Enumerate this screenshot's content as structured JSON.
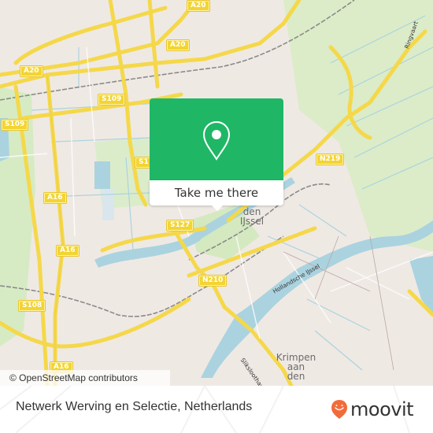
{
  "map": {
    "attribution": "© OpenStreetMap contributors",
    "popup": {
      "button_label": "Take me there",
      "icon": "location-pin-icon",
      "accent_color": "#1fb766"
    },
    "road_shields": {
      "a20_top": "A20",
      "a20_mid": "A20",
      "a20_left": "A20",
      "s109_mid": "S109",
      "s109_left": "S109",
      "s1_partial": "S1",
      "a16_upper": "A16",
      "a16_mid": "A16",
      "a16_bottom": "A16",
      "s127": "S127",
      "n219": "N219",
      "n210": "N210",
      "s108": "S108"
    },
    "place_labels": {
      "den_ijssel_line1": "den",
      "den_ijssel_line2": "IJssel",
      "krimpen_line1": "Krimpen",
      "krimpen_line2": "aan",
      "krimpen_line3": "den"
    },
    "water_labels": {
      "hollandsche_ijssel": "Hollandsche IJssel"
    },
    "road_labels": {
      "ringvaart": "Ringvaart",
      "sliksloothaven": "Sliksloothaven"
    }
  },
  "footer": {
    "title": "Netwerk Werving en Selectie, Netherlands",
    "brand": "moovit",
    "brand_color": "#f26b3a"
  }
}
